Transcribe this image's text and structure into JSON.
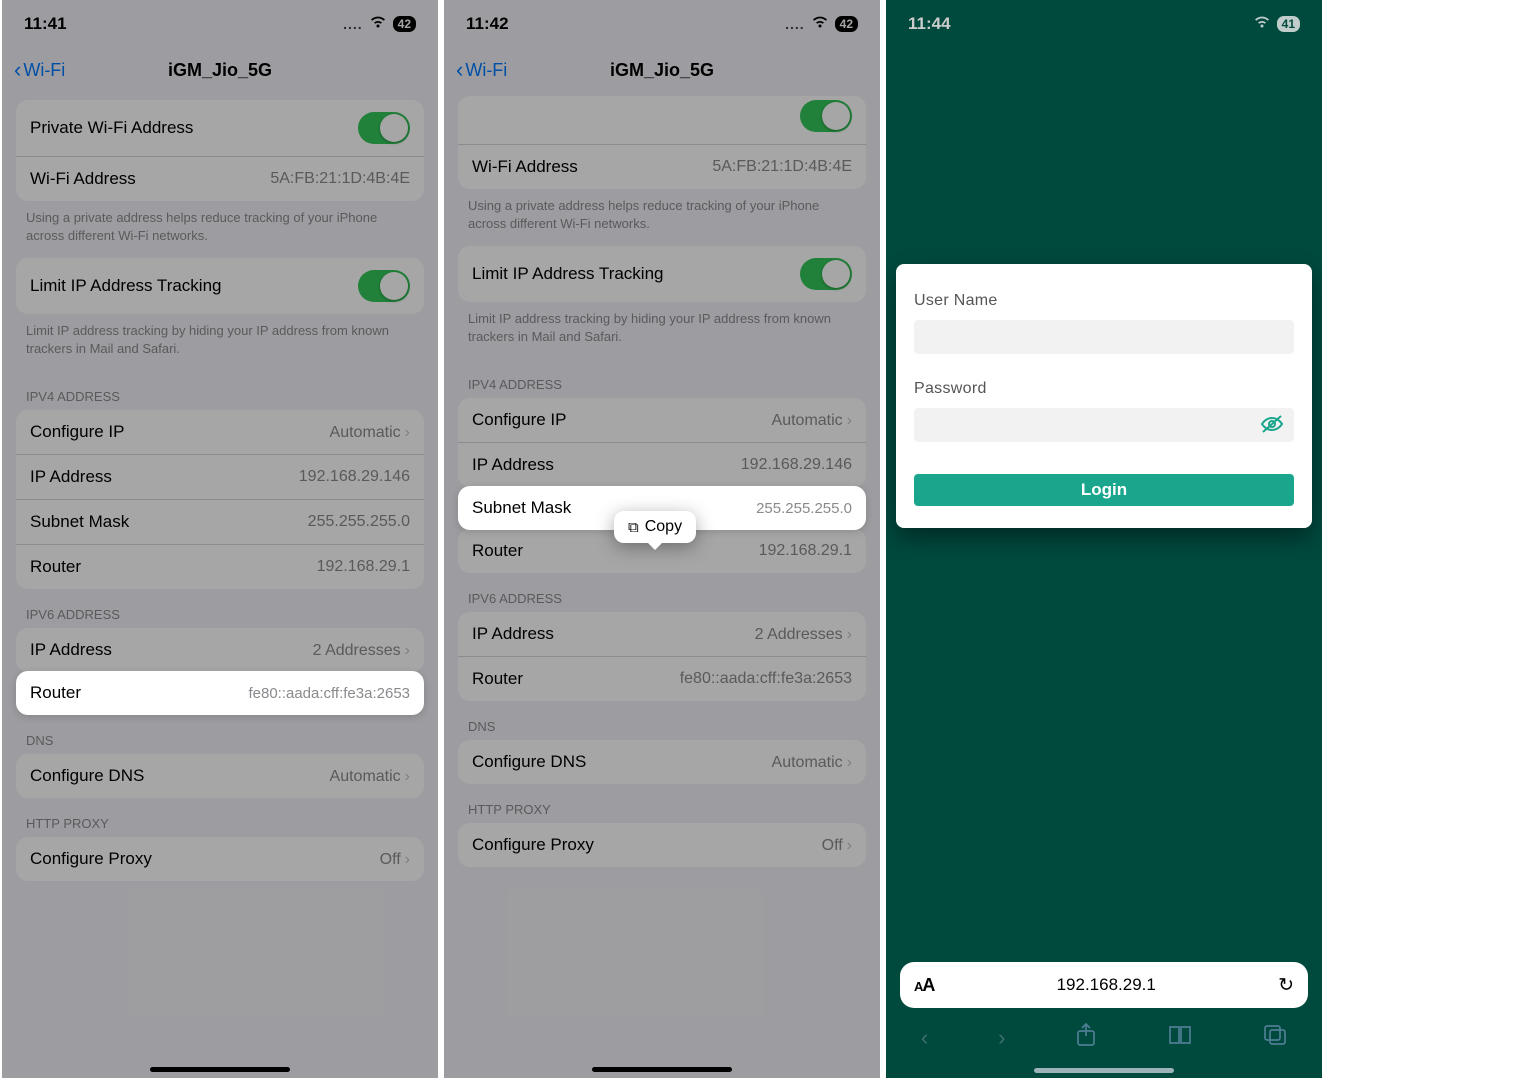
{
  "p1": {
    "time": "11:41",
    "battery": "42",
    "back": "Wi-Fi",
    "title": "iGM_Jio_5G",
    "private_label": "Private Wi-Fi Address",
    "wifi_addr_label": "Wi-Fi Address",
    "wifi_addr_val": "5A:FB:21:1D:4B:4E",
    "private_note": "Using a private address helps reduce tracking of your iPhone across different Wi-Fi networks.",
    "limit_label": "Limit IP Address Tracking",
    "limit_note": "Limit IP address tracking by hiding your IP address from known trackers in Mail and Safari.",
    "ipv4_hdr": "IPV4 ADDRESS",
    "configure_ip": "Configure IP",
    "automatic": "Automatic",
    "ip_addr_label": "IP Address",
    "ip_addr_val": "192.168.29.146",
    "subnet_label": "Subnet Mask",
    "subnet_val": "255.255.255.0",
    "router_label": "Router",
    "router_val": "192.168.29.1",
    "ipv6_hdr": "IPV6 ADDRESS",
    "ipv6_ip_val": "2 Addresses",
    "ipv6_router_val": "fe80::aada:cff:fe3a:2653",
    "dns_hdr": "DNS",
    "configure_dns": "Configure DNS",
    "http_hdr": "HTTP PROXY",
    "configure_proxy": "Configure Proxy",
    "off": "Off"
  },
  "p2": {
    "time": "11:42",
    "battery": "42",
    "back": "Wi-Fi",
    "title": "iGM_Jio_5G",
    "wifi_addr_label": "Wi-Fi Address",
    "wifi_addr_val": "5A:FB:21:1D:4B:4E",
    "private_note": "Using a private address helps reduce tracking of your iPhone across different Wi-Fi networks.",
    "limit_label": "Limit IP Address Tracking",
    "limit_note": "Limit IP address tracking by hiding your IP address from known trackers in Mail and Safari.",
    "ipv4_hdr": "IPV4 ADDRESS",
    "configure_ip": "Configure IP",
    "automatic": "Automatic",
    "ip_addr_label": "IP Address",
    "ip_addr_val": "192.168.29.146",
    "subnet_label": "Subnet Mask",
    "subnet_val": "255.255.255.0",
    "router_label": "Router",
    "router_val": "192.168.29.1",
    "ipv6_hdr": "IPV6 ADDRESS",
    "ipv6_ip_val": "2 Addresses",
    "ipv6_router_val": "fe80::aada:cff:fe3a:2653",
    "dns_hdr": "DNS",
    "configure_dns": "Configure DNS",
    "http_hdr": "HTTP PROXY",
    "configure_proxy": "Configure Proxy",
    "off": "Off",
    "copy": "Copy"
  },
  "p3": {
    "time": "11:44",
    "battery": "41",
    "username_label": "User Name",
    "password_label": "Password",
    "login_btn": "Login",
    "url": "192.168.29.1"
  }
}
